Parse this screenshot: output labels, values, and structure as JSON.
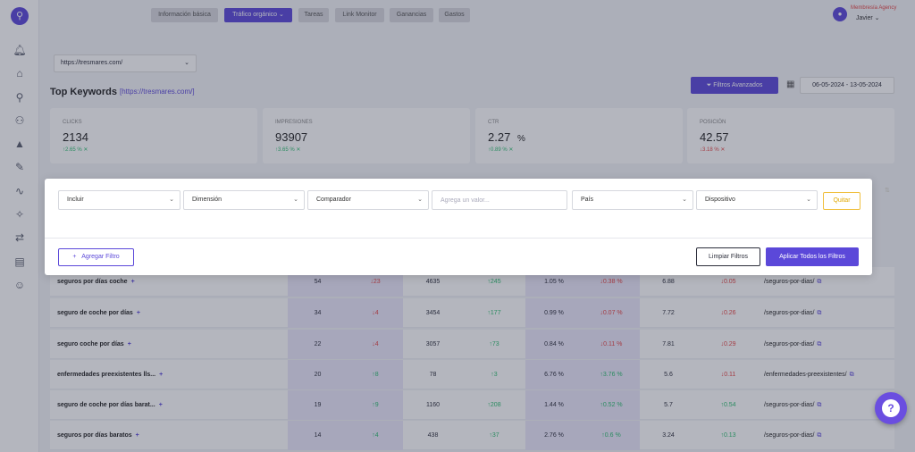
{
  "nav": {
    "tabs": [
      {
        "label": "Información básica",
        "active": false
      },
      {
        "label": "Tráfico orgánico",
        "active": true
      },
      {
        "label": "Tareas",
        "active": false
      },
      {
        "label": "Link Monitor",
        "active": false
      },
      {
        "label": "Ganancias",
        "active": false
      },
      {
        "label": "Gastos",
        "active": false
      }
    ]
  },
  "user": {
    "org": "Membresía Agency",
    "name": "Javier"
  },
  "site_select": {
    "value": "https://tresmares.com/"
  },
  "header": {
    "title": "Top Keywords",
    "site": "[https://tresmares.com/]"
  },
  "toolbar": {
    "filters_label": "Filtros Avanzados",
    "date_range": "06-05-2024 - 13-05-2024"
  },
  "cards": [
    {
      "label": "CLICKS",
      "value": "2134",
      "change": "↑2.65 %",
      "dir": "up"
    },
    {
      "label": "IMPRESIONES",
      "value": "93907",
      "change": "↑3.65 %",
      "dir": "up"
    },
    {
      "label": "CTR",
      "value": "2.27",
      "unit": "%",
      "change": "↑0.89 %",
      "dir": "up"
    },
    {
      "label": "POSICIÓN",
      "value": "42.57",
      "change": "↓3.18 %",
      "dir": "down"
    }
  ],
  "rows": [
    {
      "kw": "seguros por días coche",
      "clicks": "54",
      "clicks_chg": "↓23",
      "clicks_dir": "down",
      "impr": "4635",
      "impr_chg": "↑245",
      "impr_dir": "up",
      "ctr": "1.05 %",
      "ctr_chg": "↓0.38 %",
      "ctr_dir": "down",
      "pos": "6.88",
      "pos_chg": "↓0.05",
      "pos_dir": "down",
      "url": "/seguros-por-dias/"
    },
    {
      "kw": "seguro de coche por días",
      "clicks": "34",
      "clicks_chg": "↓4",
      "clicks_dir": "down",
      "impr": "3454",
      "impr_chg": "↑177",
      "impr_dir": "up",
      "ctr": "0.99 %",
      "ctr_chg": "↓0.07 %",
      "ctr_dir": "down",
      "pos": "7.72",
      "pos_chg": "↓0.26",
      "pos_dir": "down",
      "url": "/seguros-por-dias/"
    },
    {
      "kw": "seguro coche por días",
      "clicks": "22",
      "clicks_chg": "↓4",
      "clicks_dir": "down",
      "impr": "3057",
      "impr_chg": "↑73",
      "impr_dir": "up",
      "ctr": "0.84 %",
      "ctr_chg": "↓0.11 %",
      "ctr_dir": "down",
      "pos": "7.81",
      "pos_chg": "↓0.29",
      "pos_dir": "down",
      "url": "/seguros-por-dias/"
    },
    {
      "kw": "enfermedades preexistentes lls...",
      "clicks": "20",
      "clicks_chg": "↑8",
      "clicks_dir": "up",
      "impr": "78",
      "impr_chg": "↑3",
      "impr_dir": "up",
      "ctr": "6.76 %",
      "ctr_chg": "↑3.76 %",
      "ctr_dir": "up",
      "pos": "5.6",
      "pos_chg": "↓0.11",
      "pos_dir": "down",
      "url": "/enfermedades-preexistentes/"
    },
    {
      "kw": "seguro de coche por días barat...",
      "clicks": "19",
      "clicks_chg": "↑9",
      "clicks_dir": "up",
      "impr": "1160",
      "impr_chg": "↑208",
      "impr_dir": "up",
      "ctr": "1.44 %",
      "ctr_chg": "↑0.52 %",
      "ctr_dir": "up",
      "pos": "5.7",
      "pos_chg": "↑0.54",
      "pos_dir": "up",
      "url": "/seguros-por-dias/"
    },
    {
      "kw": "seguros por días baratos",
      "clicks": "14",
      "clicks_chg": "↑4",
      "clicks_dir": "up",
      "impr": "438",
      "impr_chg": "↑37",
      "impr_dir": "up",
      "ctr": "2.76 %",
      "ctr_chg": "↑0.6 %",
      "ctr_dir": "up",
      "pos": "3.24",
      "pos_chg": "↑0.13",
      "pos_dir": "up",
      "url": "/seguros-por-dias/"
    }
  ],
  "modal": {
    "include": "Incluir",
    "dimension": "Dimensión",
    "comparator": "Comparador",
    "value_placeholder": "Agrega un valor...",
    "country": "País",
    "device": "Dispositivo",
    "remove": "Quitar",
    "add_filter": "Agregar Filtro",
    "clear": "Limpiar Filtros",
    "apply": "Aplicar Todos los Filtros"
  }
}
